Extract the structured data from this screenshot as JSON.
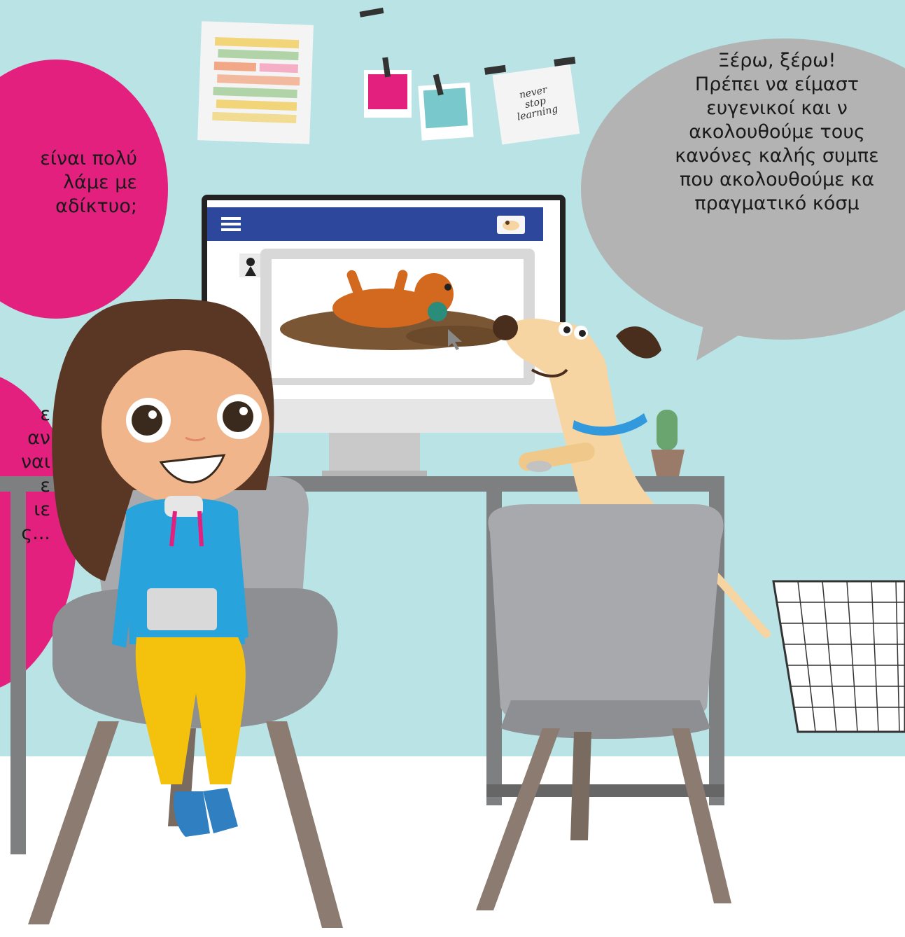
{
  "scene": {
    "speech_right": {
      "lines": [
        "Ξέρω, ξέρω!",
        "Πρέπει να είμαστ",
        "ευγενικοί και ν",
        "ακολουθούμε τους",
        "κανόνες καλής συμπε",
        "που ακολουθούμε κα",
        "πραγματικό κόσμ"
      ]
    },
    "speech_left_top": {
      "lines": [
        "είναι πολύ",
        "λάμε με",
        "αδίκτυο;"
      ]
    },
    "speech_left_bottom": {
      "lines": [
        "ε",
        "αν",
        "ναι",
        "ε",
        "ιε",
        "ς..."
      ]
    },
    "note": {
      "lines": [
        "never",
        "stop",
        "learning"
      ]
    }
  },
  "colors": {
    "wall": "#b9e3e5",
    "floor": "#ffffff",
    "pink_bubble": "#e4207f",
    "grey_bubble": "#b3b3b3",
    "monitor_header": "#2c479b",
    "desk": "#7e7f80",
    "chair_seat": "#a7a9ac",
    "chair_legs": "#8c7b70",
    "girl_hoodie": "#29a3db",
    "girl_pants": "#f4c20d",
    "dog_body": "#f6d5a2",
    "dog_collar": "#3399dd"
  },
  "icons": [
    "hamburger-menu-icon",
    "dog-avatar-icon",
    "user-avatar-icon",
    "mouse-pointer-icon",
    "plant-icon",
    "trash-bin-icon"
  ]
}
